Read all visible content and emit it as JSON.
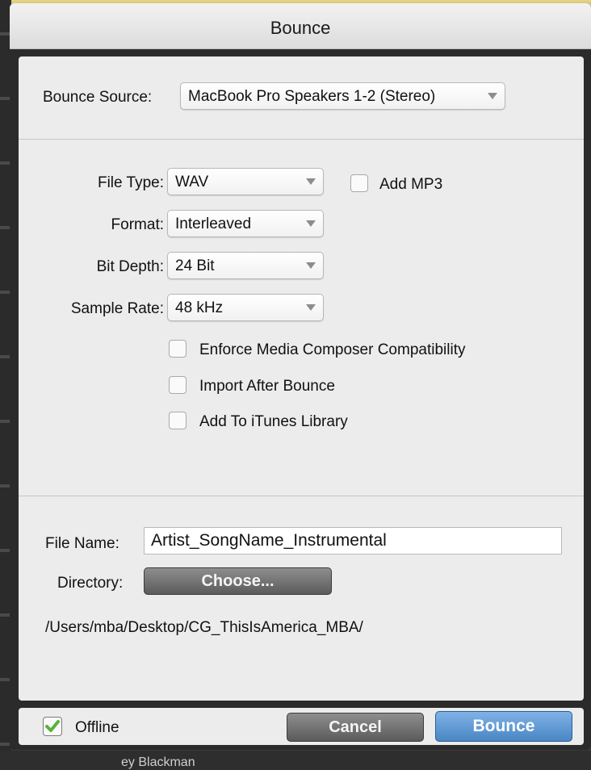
{
  "window": {
    "title": "Bounce"
  },
  "background": {
    "bottom_text": "ey Blackman"
  },
  "bounce_source": {
    "label": "Bounce Source:",
    "value": "MacBook Pro Speakers 1-2 (Stereo)"
  },
  "file_type": {
    "label": "File Type:",
    "value": "WAV"
  },
  "add_mp3": {
    "label": "Add MP3",
    "checked": false
  },
  "format": {
    "label": "Format:",
    "value": "Interleaved"
  },
  "bit_depth": {
    "label": "Bit Depth:",
    "value": "24 Bit"
  },
  "sample_rate": {
    "label": "Sample Rate:",
    "value": "48 kHz"
  },
  "options": [
    {
      "label": "Enforce Media Composer Compatibility",
      "checked": false
    },
    {
      "label": "Import After Bounce",
      "checked": false
    },
    {
      "label": "Add To iTunes Library",
      "checked": false
    }
  ],
  "file_name": {
    "label": "File Name:",
    "value": "Artist_SongName_Instrumental"
  },
  "directory": {
    "label": "Directory:",
    "button": "Choose...",
    "path": "/Users/mba/Desktop/CG_ThisIsAmerica_MBA/"
  },
  "footer": {
    "offline": {
      "label": "Offline",
      "checked": true
    },
    "cancel": "Cancel",
    "bounce": "Bounce"
  },
  "colors": {
    "check_green": "#59b13a",
    "primary_button": "#4a86c4"
  }
}
